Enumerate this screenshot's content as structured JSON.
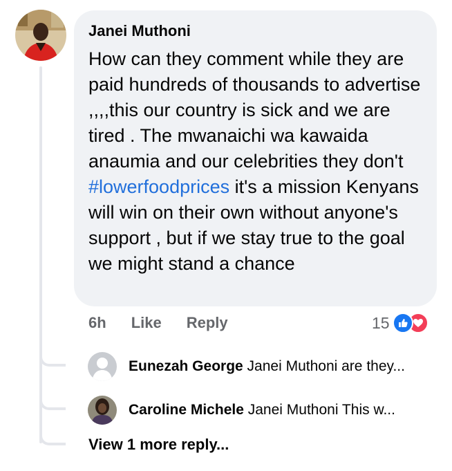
{
  "comment": {
    "author": "Janei Muthoni",
    "text_before": "How can they comment while they are paid hundreds of thousands to advertise ,,,,this our country is sick and we are tired . The mwanaichi wa kawaida anaumia and our celebrities they don't ",
    "hashtag": "#lowerfoodprices",
    "text_after": " it's a mission Kenyans will win on their own without anyone's support , but if we stay true to the goal we might stand a chance",
    "time": "6h",
    "like_label": "Like",
    "reply_label": "Reply",
    "reaction_count": "15",
    "reaction_icons": [
      "like-icon",
      "love-icon"
    ]
  },
  "replies": [
    {
      "author": "Eunezah George",
      "preview": "Janei Muthoni are they..."
    },
    {
      "author": "Caroline Michele",
      "preview": "Janei Muthoni This w..."
    }
  ],
  "view_more_label": "View 1 more reply...",
  "colors": {
    "bubble": "#f0f2f5",
    "hashtag": "#216fdb",
    "like": "#1877f2",
    "love": "#f33e58",
    "secondary_text": "#65676b"
  }
}
